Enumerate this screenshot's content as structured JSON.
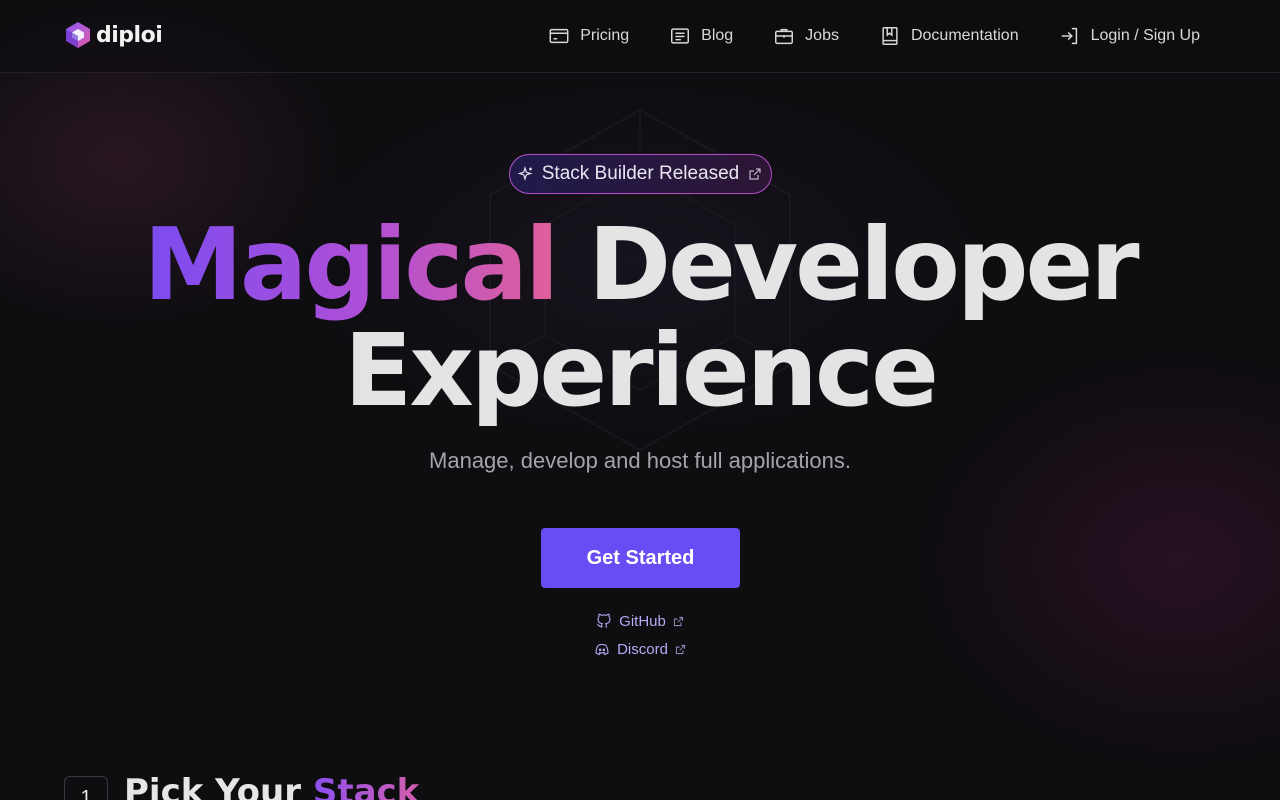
{
  "brand": {
    "name": "diploi"
  },
  "nav": [
    {
      "label": "Pricing",
      "icon": "pricing-card-icon"
    },
    {
      "label": "Blog",
      "icon": "blog-article-icon"
    },
    {
      "label": "Jobs",
      "icon": "briefcase-icon"
    },
    {
      "label": "Documentation",
      "icon": "book-icon"
    },
    {
      "label": "Login / Sign Up",
      "icon": "login-arrow-icon"
    }
  ],
  "hero": {
    "badge_label": "Stack Builder Released",
    "headline_accent": "Magical",
    "headline_rest": " Developer",
    "headline_line2": "Experience",
    "subtitle": "Manage, develop and host full applications.",
    "cta_label": "Get Started",
    "github_label": "GitHub",
    "discord_label": "Discord"
  },
  "next_section": {
    "step_number": "1",
    "title_prefix": "Pick Your ",
    "title_accent": "Stack"
  },
  "colors": {
    "background": "#0e0d10",
    "accent": "#6a4cf5",
    "gradient_start": "#7b4cf0",
    "gradient_end": "#e0609a",
    "link": "#b5a8f5"
  }
}
